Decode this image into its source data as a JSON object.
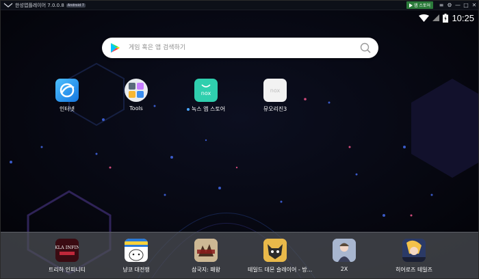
{
  "window": {
    "title": "한성앱플레이어 7.0.0.8",
    "android_badge": "Android 7",
    "store_button": "앱 스토어",
    "controls": [
      "≡",
      "⚙",
      "—",
      "□",
      "✕"
    ]
  },
  "status": {
    "time": "10:25"
  },
  "search": {
    "placeholder": "게임 혹은 앱 검색하기"
  },
  "desktop_apps": [
    {
      "label": "인터넷",
      "icon": "browser-icon"
    },
    {
      "label": "Tools",
      "icon": "tools-folder-icon"
    },
    {
      "label": "녹스 앱 스토어",
      "icon": "nox-store-icon",
      "has_update_dot": true
    },
    {
      "label": "뮤오리진3",
      "icon": "nox-placeholder-icon"
    }
  ],
  "dock_apps": [
    {
      "label": "트리하 인피니티",
      "icon": "trickster-infinity-icon",
      "logo_text": "TRIKLA INFINITY"
    },
    {
      "label": "냥코 대전쟁",
      "icon": "battle-cats-icon"
    },
    {
      "label": "삼국지: 패왕",
      "icon": "three-kingdoms-icon"
    },
    {
      "label": "테일드 데몬 슬레이어 - 방...",
      "icon": "tailed-demon-slayer-icon"
    },
    {
      "label": "2X",
      "icon": "2x-icon"
    },
    {
      "label": "히어로즈 테일즈",
      "icon": "heroes-tales-icon"
    }
  ],
  "colors": {
    "dock": "#4e5056",
    "store_button": "#2b7a3a",
    "accent_dot": "#4aa6ff"
  }
}
